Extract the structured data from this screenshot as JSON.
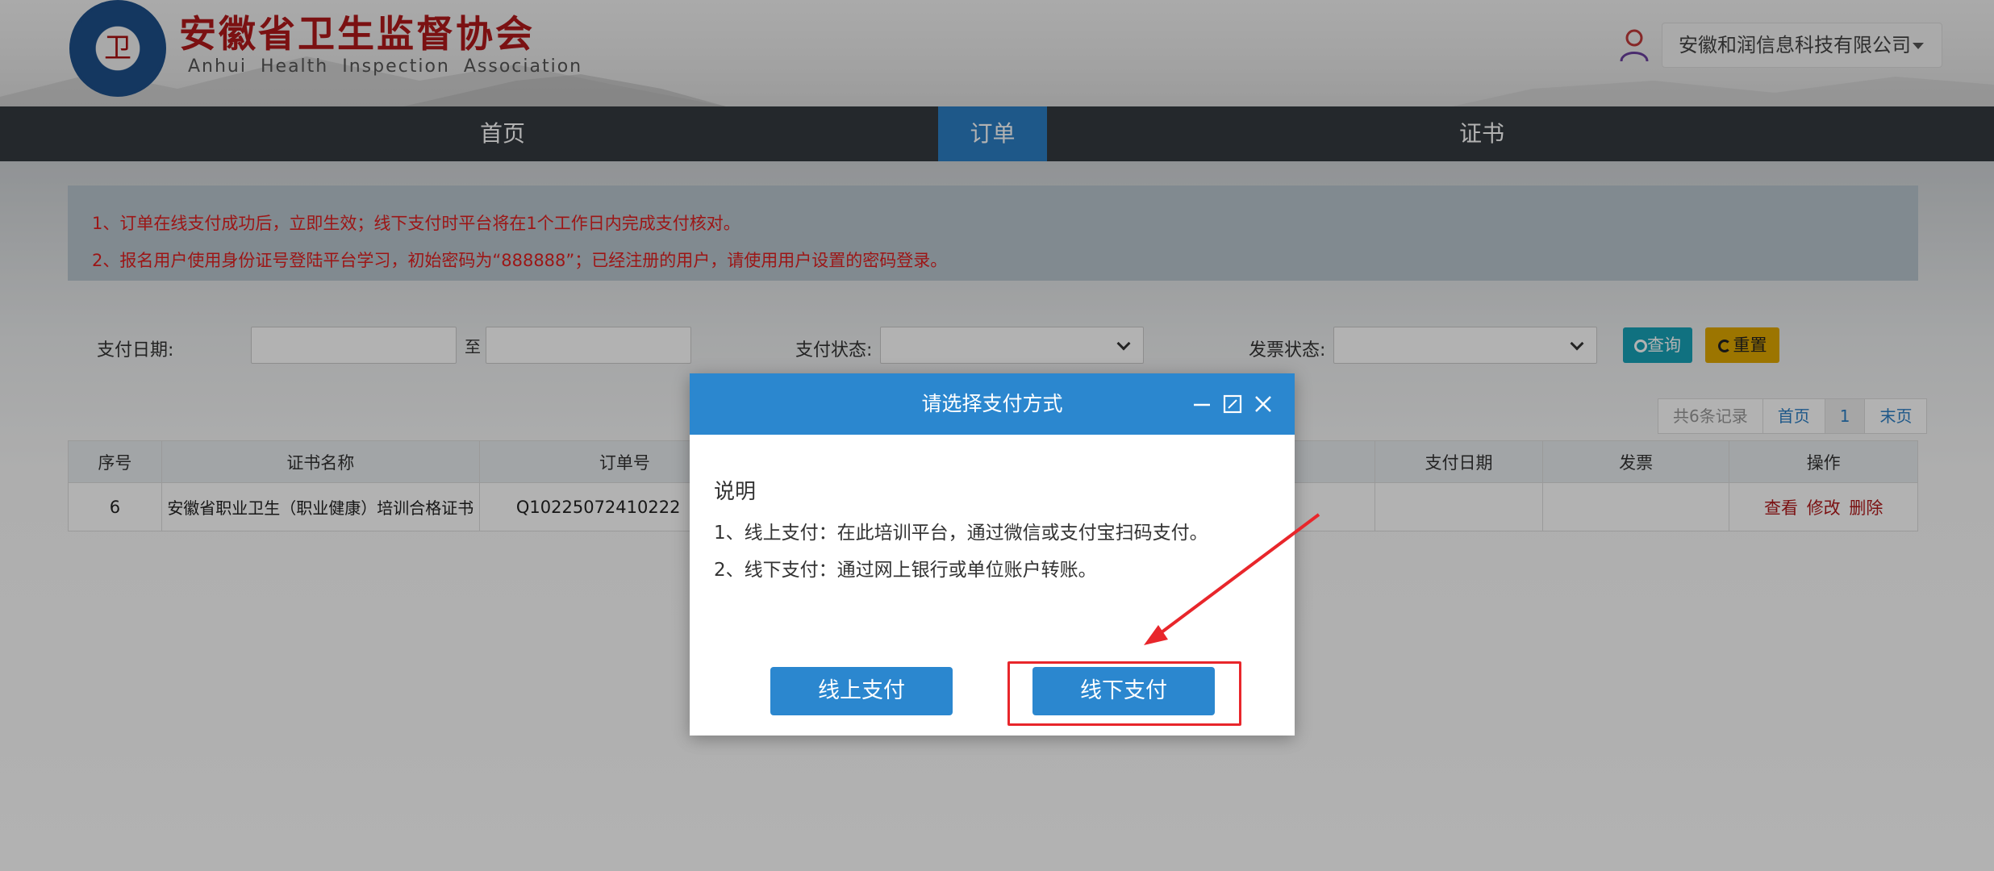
{
  "header": {
    "title": "安徽省卫生监督协会",
    "subtitle": "Anhui Health Inspection Association",
    "logo_text": "安徽省卫生监督协会",
    "user": "安徽和润信息科技有限公司"
  },
  "nav": {
    "items": [
      {
        "label": "首页",
        "active": false
      },
      {
        "label": "订单",
        "active": true
      },
      {
        "label": "证书",
        "active": false
      }
    ]
  },
  "notice": {
    "lines": [
      "1、订单在线支付成功后，立即生效；线下支付时平台将在1个工作日内完成支付核对。",
      "2、报名用户使用身份证号登陆平台学习，初始密码为“888888”；已经注册的用户，请使用用户设置的密码登录。"
    ]
  },
  "filters": {
    "pay_date_label": "支付日期:",
    "to_label": "至",
    "pay_status_label": "支付状态:",
    "invoice_status_label": "发票状态:",
    "query_label": "查询",
    "reset_label": "重置"
  },
  "pager": {
    "info": "共6条记录",
    "first": "首页",
    "current": "1",
    "last": "末页"
  },
  "table": {
    "headers": {
      "index": "序号",
      "cert_name": "证书名称",
      "order_no": "订单号",
      "pay_date": "支付日期",
      "invoice": "发票",
      "actions": "操作"
    },
    "rows": [
      {
        "index": "6",
        "cert_name": "安徽省职业卫生（职业健康）培训合格证书",
        "order_no": "Q10225072410222",
        "pay_date": "",
        "invoice": "",
        "view": "查看",
        "edit": "修改",
        "delete": "删除"
      }
    ]
  },
  "modal": {
    "title": "请选择支付方式",
    "heading": "说明",
    "lines": [
      "1、线上支付：在此培训平台，通过微信或支付宝扫码支付。",
      "2、线下支付：通过网上银行或单位账户转账。"
    ],
    "online_label": "线上支付",
    "offline_label": "线下支付"
  },
  "colors": {
    "primary": "#2b87cf",
    "nav_bg": "#343a40",
    "brand_red": "#b0191b",
    "notice_red": "#e02020",
    "highlight": "#e8262b"
  }
}
